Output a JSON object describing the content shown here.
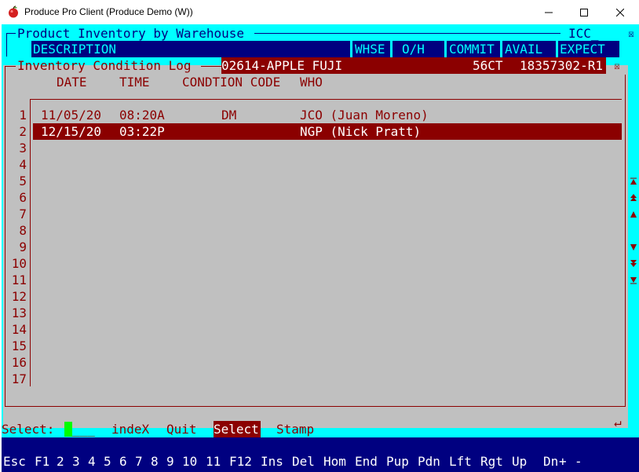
{
  "window": {
    "title": "Produce Pro Client (Produce Demo (W))"
  },
  "outer": {
    "title": "Product Inventory by Warehouse",
    "code": "ICC_",
    "close_glyph": "☒",
    "columns": {
      "description": "DESCRIPTION",
      "whse": "WHSE",
      "oh": "O/H",
      "commit": "COMMIT",
      "avail": "AVAIL",
      "expect": "EXPECT"
    }
  },
  "dialog": {
    "title": "Inventory Condition Log",
    "product": "02614-APPLE FUJI",
    "pack": "56CT",
    "lot": "18357302-R1",
    "close_glyph": "☒",
    "headers": {
      "date": "DATE",
      "time": "TIME",
      "condition": "CONDTION CODE",
      "who": "WHO"
    },
    "row_numbers": [
      "1",
      "2",
      "3",
      "4",
      "5",
      "6",
      "7",
      "8",
      "9",
      "10",
      "11",
      "12",
      "13",
      "14",
      "15",
      "16",
      "17"
    ],
    "rows": [
      {
        "date": "11/05/20",
        "time": "08:20A",
        "code": "DM",
        "who": "JCO (Juan Moreno)"
      },
      {
        "date": "12/15/20",
        "time": "03:22P",
        "code": "",
        "who": "NGP (Nick Pratt)"
      }
    ],
    "selected_row": 2,
    "enter_glyph": "↵"
  },
  "menu": {
    "select_label": "Select:",
    "select_blanks": "___",
    "items": {
      "index": "indeX",
      "quit": "Quit",
      "select": "Select",
      "stamp": "Stamp"
    }
  },
  "fkeys": [
    "Esc",
    "F1",
    "2",
    "3",
    "4",
    "5",
    "6",
    "7",
    "8",
    "9",
    "10",
    "11",
    "F12",
    "Ins",
    "Del",
    "Hom",
    "End",
    "Pup",
    "Pdn",
    "Lft",
    "Rgt",
    "Up",
    "Dn",
    "+",
    "-"
  ],
  "colors": {
    "cyan": "#00ffff",
    "navy": "#000080",
    "maroon": "#8b0000",
    "gray": "#c0c0c0",
    "green": "#00ff00"
  }
}
